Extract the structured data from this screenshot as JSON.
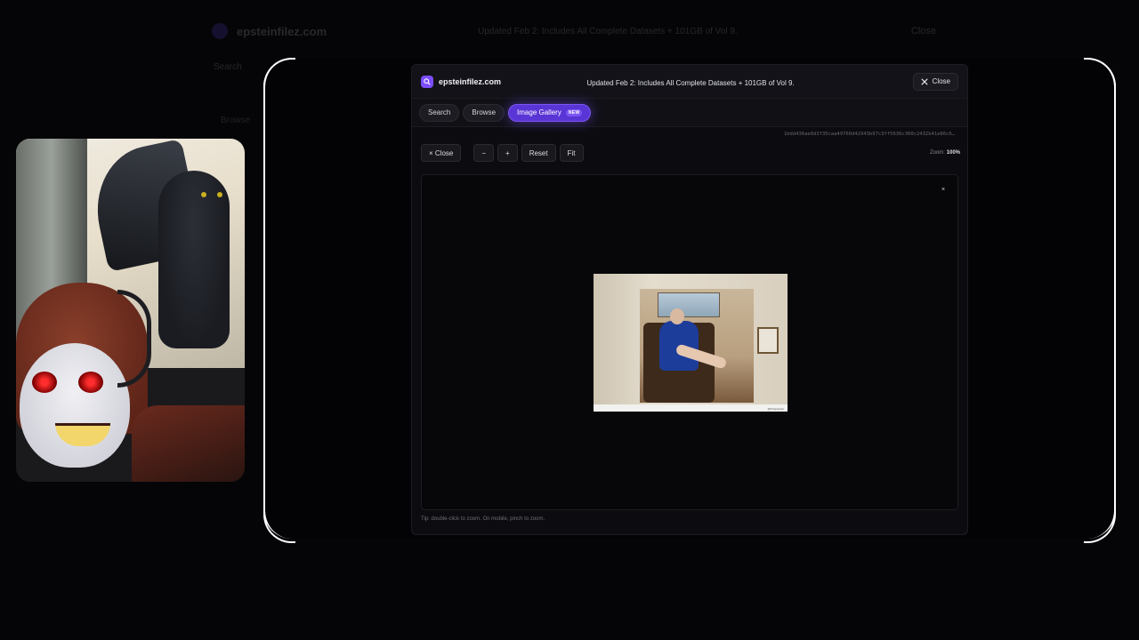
{
  "background": {
    "logo_text": "epsteinfilez.com",
    "banner": "Updated Feb 2: Includes All Complete Datasets + 101GB of Vol 9.",
    "close": "Close",
    "tab_search": "Search",
    "tab_browse": "Browse"
  },
  "header": {
    "brand": "epsteinfilez.com",
    "banner": "Updated Feb 2: Includes All Complete Datasets + 101GB of Vol 9.",
    "close_label": "Close"
  },
  "tabs": [
    {
      "label": "Search"
    },
    {
      "label": "Browse"
    },
    {
      "label": "Image Gallery",
      "badge": "NEW"
    }
  ],
  "viewer": {
    "hash": "1bdd436ae0d3f35caa49760d42943b97c3ff5636c300c2432b41e86c6…",
    "toolbar": {
      "close": "× Close",
      "zoom_out": "−",
      "zoom_in": "+",
      "reset": "Reset",
      "fit": "Fit",
      "zoom_label": "Zoom:",
      "zoom_value": "100%"
    },
    "close_x": "×",
    "tip": "Tip: double-click to zoom. On mobile, pinch to zoom.",
    "image_caption": "@Pinkpantiez"
  },
  "colors": {
    "accent": "#5a35d6",
    "background": "#0c0c10"
  }
}
